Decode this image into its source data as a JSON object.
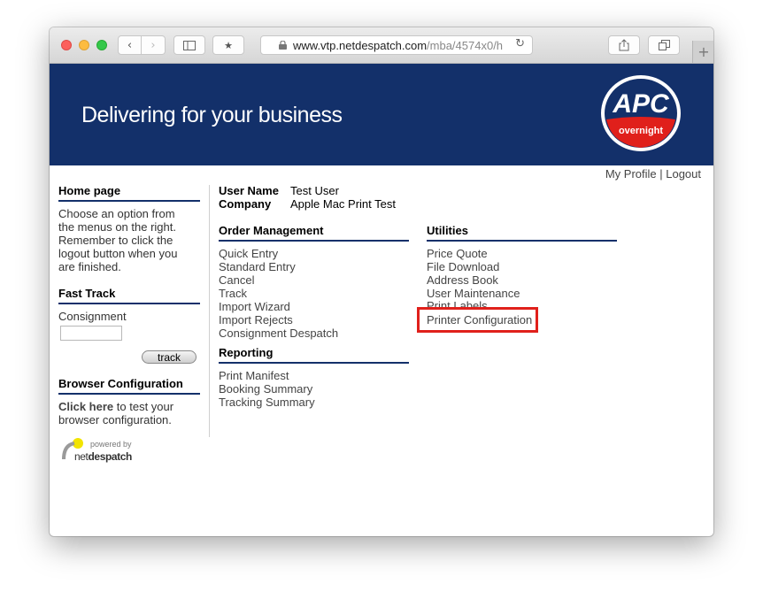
{
  "browser": {
    "url_host": "www.vtp.netdespatch.com",
    "url_path": "/mba/4574x0/h"
  },
  "banner": {
    "tagline": "Delivering for your business",
    "logo_text": "APC",
    "logo_subtext": "overnight"
  },
  "toplinks": {
    "profile": "My Profile",
    "separator": " | ",
    "logout": "Logout"
  },
  "user": {
    "name_label": "User Name",
    "name_value": "Test User",
    "company_label": "Company",
    "company_value": "Apple Mac Print Test"
  },
  "home": {
    "heading": "Home page",
    "lines": [
      "Choose an option from",
      "the menus on the right.",
      "Remember to click the",
      "logout button when you",
      "are finished."
    ]
  },
  "fast_track": {
    "heading": "Fast Track",
    "label": "Consignment",
    "button": "track"
  },
  "browser_config": {
    "heading": "Browser Configuration",
    "link": "Click here",
    "rest": " to test your",
    "line2": "browser configuration."
  },
  "powered": {
    "small": "powered by",
    "brand_a": "net",
    "brand_b": "despatch"
  },
  "order_management": {
    "heading": "Order Management",
    "items": [
      "Quick Entry",
      "Standard Entry",
      "Cancel",
      "Track",
      "Import Wizard",
      "Import Rejects",
      "Consignment Despatch"
    ]
  },
  "reporting": {
    "heading": "Reporting",
    "items": [
      "Print Manifest",
      "Booking Summary",
      "Tracking Summary"
    ]
  },
  "utilities": {
    "heading": "Utilities",
    "items": [
      "Price Quote",
      "File Download",
      "Address Book",
      "User Maintenance",
      "Print Labels",
      "Printer Configuration"
    ]
  },
  "colors": {
    "banner": "#13306a",
    "accent_red": "#e0201b"
  }
}
